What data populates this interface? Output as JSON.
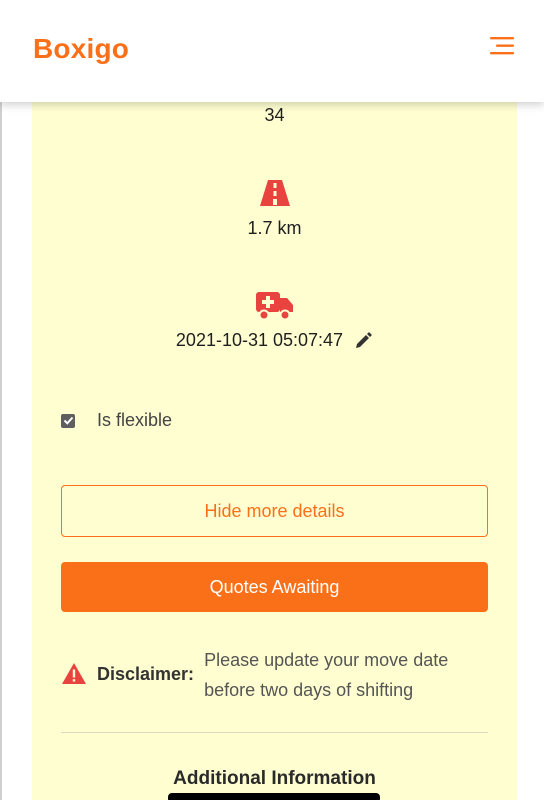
{
  "header": {
    "brand": "Boxigo",
    "menu_icon": "hamburger-menu-icon"
  },
  "details": {
    "count_value": "34",
    "distance_icon": "road-icon",
    "distance": "1.7 km",
    "date_icon": "truck-medical-icon",
    "move_date": "2021-10-31 05:07:47",
    "edit_icon": "pencil-icon"
  },
  "flexible": {
    "label": "Is flexible",
    "checked": true
  },
  "buttons": {
    "hide_details": "Hide more details",
    "quotes_awaiting": "Quotes Awaiting"
  },
  "disclaimer": {
    "icon": "warning-triangle-icon",
    "label": "Disclaimer:",
    "text": "Please update your move date before two days of shifting"
  },
  "additional": {
    "title": "Additional Information"
  },
  "colors": {
    "accent": "#fa7019",
    "icon_red": "#e8433f",
    "card_bg": "#fefed1"
  }
}
